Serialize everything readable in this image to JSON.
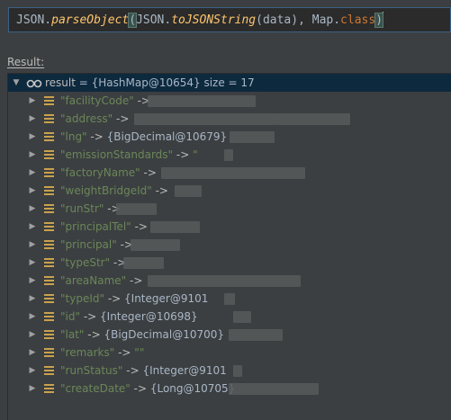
{
  "expression": {
    "part1": "JSON.",
    "part2": "parseObject",
    "part3": "(",
    "part4": "JSON.",
    "part5": "toJSONString",
    "part6": "(data), Map.",
    "part7": "class",
    "part8": ")"
  },
  "result_label": "Result:",
  "root": {
    "name": "result",
    "value": " = {HashMap@10654}  size = 17"
  },
  "entries": [
    {
      "key": "\"facilityCode\"",
      "sep": " ->",
      "value": ""
    },
    {
      "key": "\"address\"",
      "sep": " ->",
      "value": ""
    },
    {
      "key": "\"lng\"",
      "sep": " -> ",
      "value": "{BigDecimal@10679}"
    },
    {
      "key": "\"emissionStandards\"",
      "sep": " -> ",
      "value": "\""
    },
    {
      "key": "\"factoryName\"",
      "sep": " ->",
      "value": ""
    },
    {
      "key": "\"weightBridgeId\"",
      "sep": " ->",
      "value": ""
    },
    {
      "key": "\"runStr\"",
      "sep": " ->",
      "value": ""
    },
    {
      "key": "\"principalTel\"",
      "sep": " ->",
      "value": ""
    },
    {
      "key": "\"principal\"",
      "sep": " ->",
      "value": ""
    },
    {
      "key": "\"typeStr\"",
      "sep": " ->",
      "value": ""
    },
    {
      "key": "\"areaName\"",
      "sep": " ->",
      "value": ""
    },
    {
      "key": "\"typeId\"",
      "sep": " -> ",
      "value": "{Integer@9101"
    },
    {
      "key": "\"id\"",
      "sep": " -> ",
      "value": "{Integer@10698}"
    },
    {
      "key": "\"lat\"",
      "sep": " -> ",
      "value": "{BigDecimal@10700}"
    },
    {
      "key": "\"remarks\"",
      "sep": " -> ",
      "value": "\"\""
    },
    {
      "key": "\"runStatus\"",
      "sep": " -> ",
      "value": "{Integer@9101"
    },
    {
      "key": "\"createDate\"",
      "sep": " -> ",
      "value": "{Long@10705}"
    }
  ],
  "icons": {
    "expand_collapsed": "chevron-right-icon",
    "expand_open": "chevron-down-icon",
    "map_entry": "map-entry-icon",
    "watch": "watch-glasses-icon"
  },
  "colors": {
    "background": "#3c3f41",
    "editor_bg": "#2b2b2b",
    "selection": "#0d293e",
    "string": "#6a8759",
    "keyword": "#cc7832",
    "method": "#ffc66d",
    "map_icon": "#c9a24e"
  }
}
